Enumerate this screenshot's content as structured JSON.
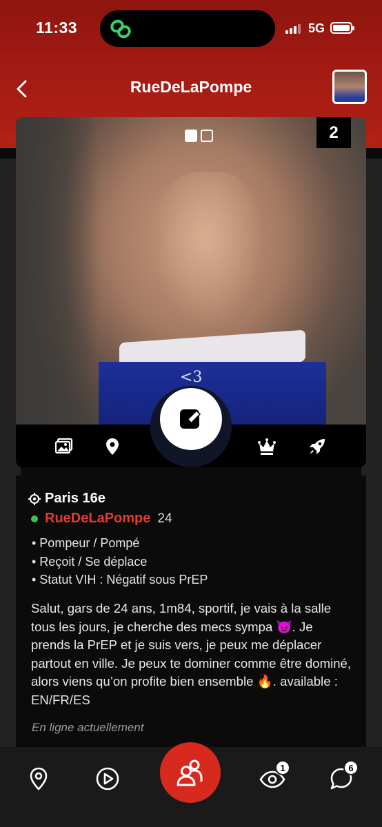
{
  "status_bar": {
    "time": "11:33",
    "network": "5G"
  },
  "header": {
    "title": "RueDeLaPompe"
  },
  "photo": {
    "overlay_text": "<3",
    "photo_count": "2",
    "pages_total": 2,
    "page_active": 1
  },
  "profile": {
    "location": "Paris 16e",
    "name": "RueDeLaPompe",
    "age": "24",
    "details": [
      "• Pompeur / Pompé",
      "• Reçoit / Se déplace",
      "• Statut VIH : Négatif sous PrEP"
    ],
    "bio": "Salut, gars de 24 ans, 1m84, sportif, je vais à la salle tous les jours, je cherche des mecs sympa 😈. Je prends la PrEP et je suis vers, je peux me déplacer partout en ville. Je peux te dominer comme être dominé, alors viens qu’on profite bien ensemble 🔥. available : EN/FR/ES",
    "status": "En ligne actuellement"
  },
  "nav": {
    "views_badge": "1",
    "messages_badge": "6"
  },
  "colors": {
    "accent": "#d8291f",
    "name": "#e63b2e",
    "online": "#3fbf4f"
  }
}
